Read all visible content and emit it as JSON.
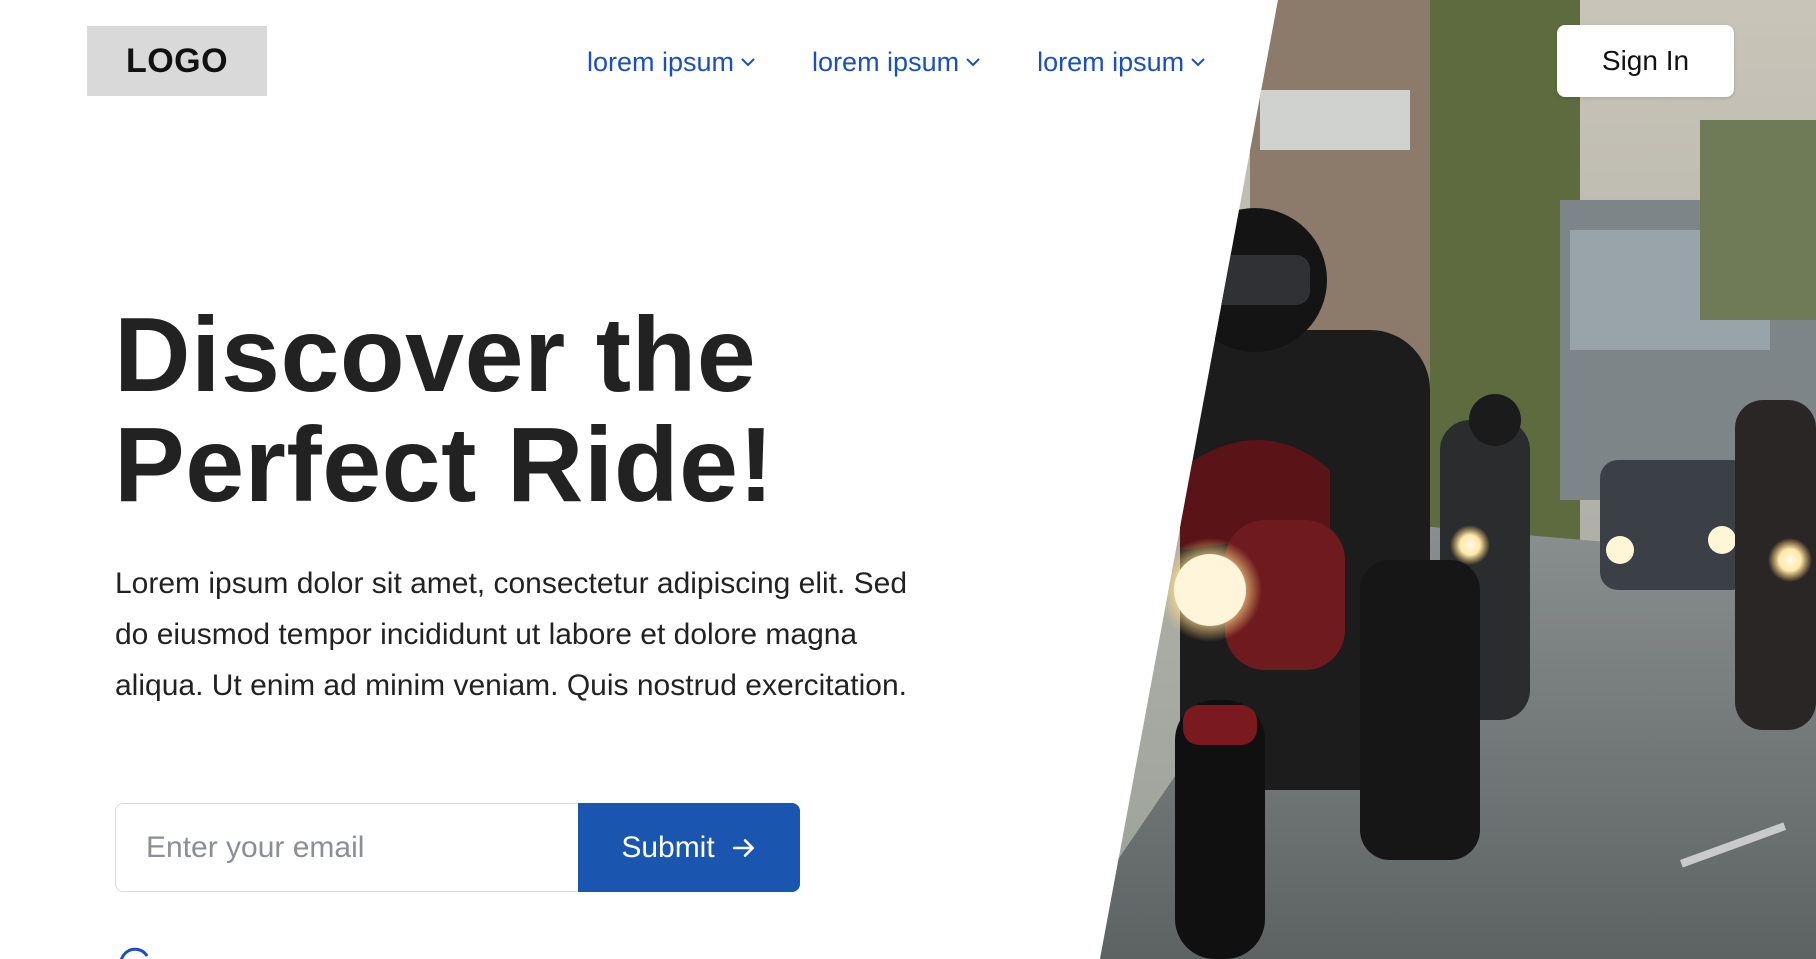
{
  "header": {
    "logo": "LOGO",
    "nav": [
      {
        "label": "lorem ipsum",
        "icon": "chevron-down-icon"
      },
      {
        "label": "lorem ipsum",
        "icon": "chevron-down-icon"
      },
      {
        "label": "lorem ipsum",
        "icon": "chevron-down-icon"
      }
    ],
    "sign_in_label": "Sign In"
  },
  "hero": {
    "headline_line1": "Discover the",
    "headline_line2": "Perfect Ride!",
    "description": "Lorem ipsum dolor sit amet, consectetur adipiscing elit. Sed do eiusmod tempor incididunt ut labore et dolore magna aliqua. Ut enim ad minim veniam. Quis nostrud exercitation.",
    "email_placeholder": "Enter your email",
    "submit_label": "Submit",
    "submit_icon": "arrow-right-icon",
    "note_icon": "check-circle-icon"
  },
  "image": {
    "subject": "motorcyclists-riding-on-village-street"
  },
  "colors": {
    "accent": "#1a56b0",
    "nav_link": "#1a4fc2",
    "logo_bg": "#d9d9d9",
    "text": "#222222"
  }
}
